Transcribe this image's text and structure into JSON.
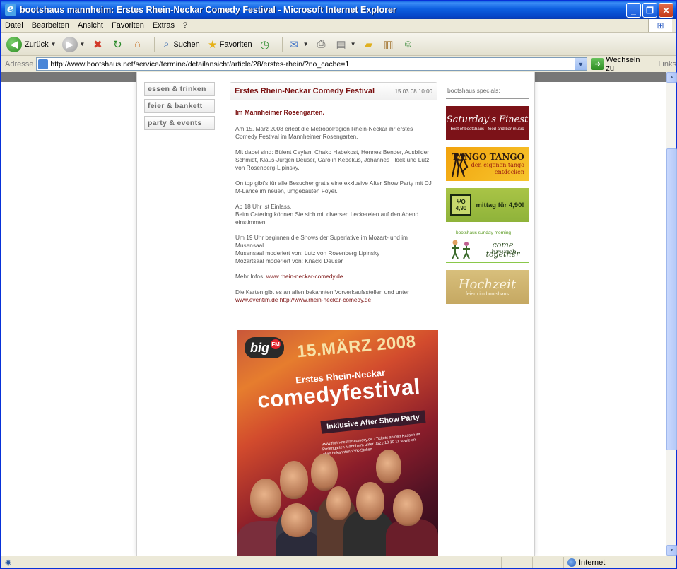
{
  "window": {
    "title": "bootshaus mannheim: Erstes Rhein-Neckar Comedy Festival - Microsoft Internet Explorer"
  },
  "menu": [
    "Datei",
    "Bearbeiten",
    "Ansicht",
    "Favoriten",
    "Extras",
    "?"
  ],
  "toolbar": {
    "back_label": "Zurück",
    "search_label": "Suchen",
    "favorites_label": "Favoriten"
  },
  "address": {
    "label": "Adresse",
    "url": "http://www.bootshaus.net/service/termine/detailansicht/article/28/erstes-rhein/?no_cache=1",
    "go_label": "Wechseln zu",
    "links_label": "Links"
  },
  "nav": [
    "essen & trinken",
    "feier & bankett",
    "party & events"
  ],
  "article": {
    "title": "Erstes Rhein-Neckar Comedy Festival",
    "date": "15.03.08 10:00",
    "lead": "Im Mannheimer Rosengarten.",
    "p1": "Am 15. März 2008 erlebt die Metropolregion Rhein-Neckar ihr erstes Comedy Festival im Mannheimer Rosengarten.",
    "p2": "Mit dabei sind: Bülent Ceylan, Chako Habekost, Hennes Bender, Ausbilder Schmidt, Klaus-Jürgen Deuser, Carolin Kebekus, Johannes Flöck und Lutz von Rosenberg-Lipinsky.",
    "p3": "On top gibt's für alle Besucher gratis eine exklusive After Show Party mit DJ M-Lance im neuen, umgebauten Foyer.",
    "p4a": "Ab 18 Uhr ist Einlass.",
    "p4b": "Beim Catering können Sie sich mit diversen Leckereien auf den Abend einstimmen.",
    "p5a": "Um 19 Uhr beginnen die Shows der Superlative im Mozart- und im Musensaal.",
    "p5b": "Musensaal moderiert von: Lutz von Rosenberg Lipinsky",
    "p5c": "Mozartsaal moderiert von: Knacki Deuser",
    "more_label": "Mehr Infos:",
    "more_link": "www.rhein-neckar-comedy.de",
    "tickets_text": "Die Karten gibt es an allen bekannten Vorverkaufsstellen und unter",
    "tickets_link1": "www.eventim.de",
    "tickets_link2": "http://www.rhein-neckar-comedy.de"
  },
  "poster": {
    "brand": "big",
    "brand_fm": "FM",
    "date": "15.MÄRZ 2008",
    "line1": "Erstes Rhein-Neckar",
    "line2": "comedyfestival",
    "ribbon": "Inklusive After Show Party",
    "small": "www.rhein-neckar-comedy.de · Tickets an den Kassen im Rosengarten Mannheim unter 0621-10 10 11 sowie an allen bekannten VVK-Stellen"
  },
  "specials": {
    "heading": "bootshaus specials:",
    "b1_title": "Saturday's Finest",
    "b1_sub": "best of bootshaus - food and bar music",
    "b2_title": "TANGO TANGO",
    "b2_sub1": "den eigenen tango",
    "b2_sub2": "entdecken",
    "b3_price": "4,90",
    "b3_title": "mittag für 4,90!",
    "b4_top": "bootshaus sunday morning",
    "b4_line1": "come together",
    "b4_line2": "brunch",
    "b5_title": "Hochzeit",
    "b5_sub": "feiern im bootshaus"
  },
  "status": {
    "zone": "Internet"
  }
}
